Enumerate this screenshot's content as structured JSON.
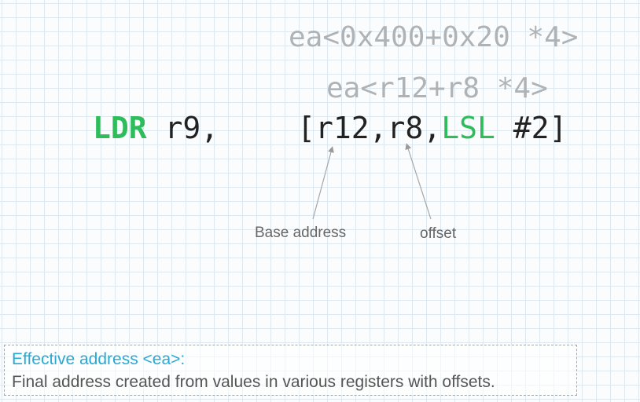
{
  "expressions": {
    "numeric": "ea<0x400+0x20 *4>",
    "symbolic": "ea<r12+r8 *4>"
  },
  "instruction": {
    "opcode": "LDR",
    "dest": " r9,",
    "operand_open": "[r12,r8,",
    "shift_op": "LSL",
    "shift_amount": " #2]"
  },
  "annotations": {
    "base_address": "Base address",
    "offset": "offset"
  },
  "definition": {
    "title": "Effective address <ea>:",
    "text": "Final address created from values in various registers with offsets."
  },
  "colors": {
    "keyword": "#2ebd5a",
    "muted_text": "#b0b3b6",
    "definition_title": "#29a9d6",
    "definition_border": "#5ec3e3"
  }
}
